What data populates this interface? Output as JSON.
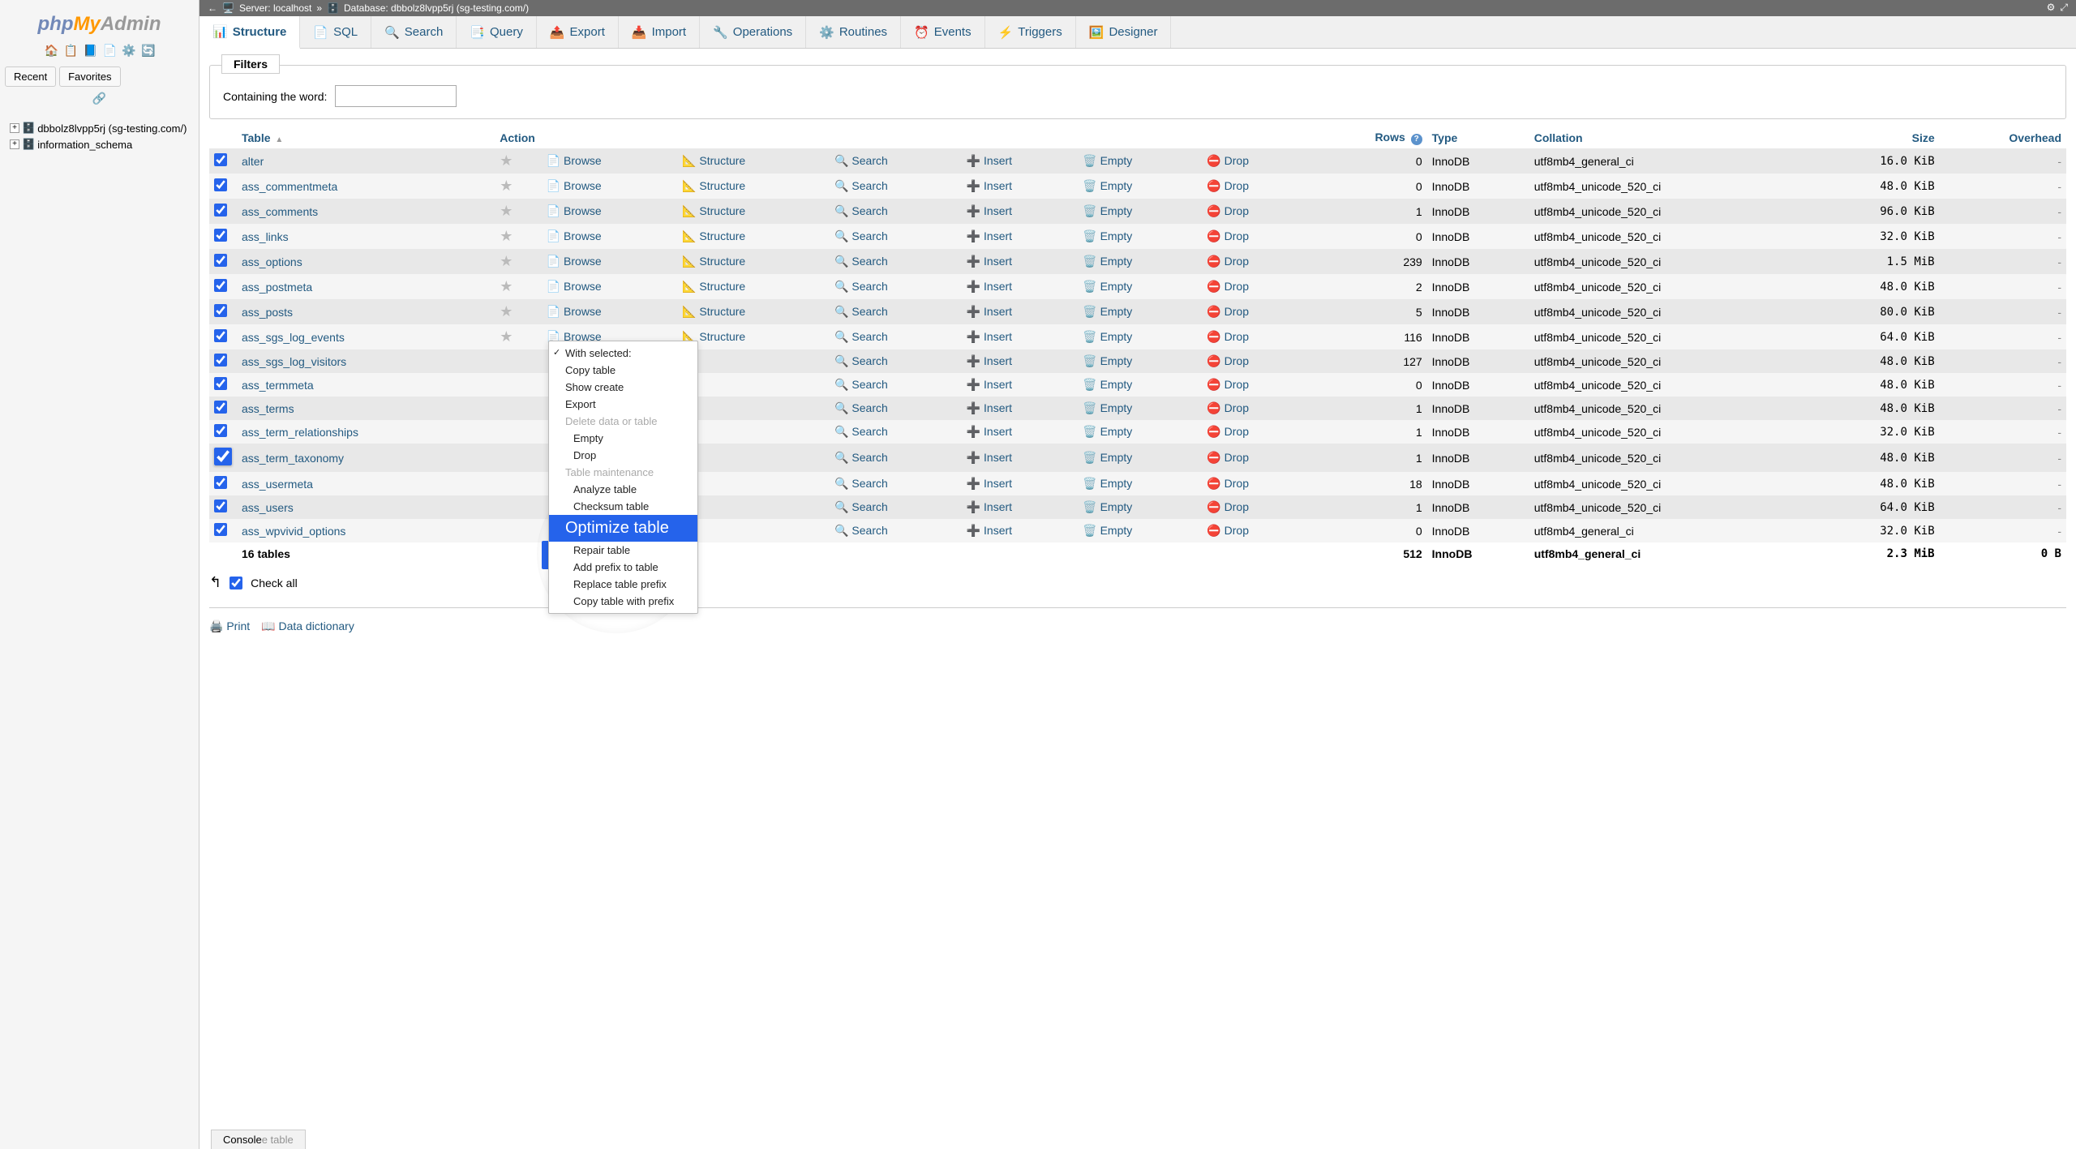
{
  "logo": {
    "php": "php",
    "my": "My",
    "admin": "Admin"
  },
  "sidebar": {
    "recent": "Recent",
    "favorites": "Favorites",
    "tree": [
      {
        "name": "dbbolz8lvpp5rj (sg-testing.com/)"
      },
      {
        "name": "information_schema"
      }
    ]
  },
  "breadcrumb": {
    "server_label": "Server:",
    "server": "localhost",
    "sep": "»",
    "db_label": "Database:",
    "db": "dbbolz8lvpp5rj (sg-testing.com/)"
  },
  "tabs": {
    "structure": "Structure",
    "sql": "SQL",
    "search": "Search",
    "query": "Query",
    "export": "Export",
    "import": "Import",
    "operations": "Operations",
    "routines": "Routines",
    "events": "Events",
    "triggers": "Triggers",
    "designer": "Designer"
  },
  "filters": {
    "legend": "Filters",
    "contain_label": "Containing the word:",
    "value": ""
  },
  "headers": {
    "table": "Table",
    "action": "Action",
    "rows": "Rows",
    "type": "Type",
    "collation": "Collation",
    "size": "Size",
    "overhead": "Overhead"
  },
  "actions": {
    "browse": "Browse",
    "structure": "Structure",
    "search": "Search",
    "insert": "Insert",
    "empty": "Empty",
    "drop": "Drop"
  },
  "rows": [
    {
      "name": "alter",
      "rows": 0,
      "type": "InnoDB",
      "collation": "utf8mb4_general_ci",
      "size": "16.0 KiB",
      "overhead": "-"
    },
    {
      "name": "ass_commentmeta",
      "rows": 0,
      "type": "InnoDB",
      "collation": "utf8mb4_unicode_520_ci",
      "size": "48.0 KiB",
      "overhead": "-"
    },
    {
      "name": "ass_comments",
      "rows": 1,
      "type": "InnoDB",
      "collation": "utf8mb4_unicode_520_ci",
      "size": "96.0 KiB",
      "overhead": "-"
    },
    {
      "name": "ass_links",
      "rows": 0,
      "type": "InnoDB",
      "collation": "utf8mb4_unicode_520_ci",
      "size": "32.0 KiB",
      "overhead": "-"
    },
    {
      "name": "ass_options",
      "rows": 239,
      "type": "InnoDB",
      "collation": "utf8mb4_unicode_520_ci",
      "size": "1.5 MiB",
      "overhead": "-"
    },
    {
      "name": "ass_postmeta",
      "rows": 2,
      "type": "InnoDB",
      "collation": "utf8mb4_unicode_520_ci",
      "size": "48.0 KiB",
      "overhead": "-"
    },
    {
      "name": "ass_posts",
      "rows": 5,
      "type": "InnoDB",
      "collation": "utf8mb4_unicode_520_ci",
      "size": "80.0 KiB",
      "overhead": "-"
    },
    {
      "name": "ass_sgs_log_events",
      "rows": 116,
      "type": "InnoDB",
      "collation": "utf8mb4_unicode_520_ci",
      "size": "64.0 KiB",
      "overhead": "-"
    },
    {
      "name": "ass_sgs_log_visitors",
      "rows": 127,
      "type": "InnoDB",
      "collation": "utf8mb4_unicode_520_ci",
      "size": "48.0 KiB",
      "overhead": "-"
    },
    {
      "name": "ass_termmeta",
      "rows": 0,
      "type": "InnoDB",
      "collation": "utf8mb4_unicode_520_ci",
      "size": "48.0 KiB",
      "overhead": "-"
    },
    {
      "name": "ass_terms",
      "rows": 1,
      "type": "InnoDB",
      "collation": "utf8mb4_unicode_520_ci",
      "size": "48.0 KiB",
      "overhead": "-"
    },
    {
      "name": "ass_term_relationships",
      "rows": 1,
      "type": "InnoDB",
      "collation": "utf8mb4_unicode_520_ci",
      "size": "32.0 KiB",
      "overhead": "-"
    },
    {
      "name": "ass_term_taxonomy",
      "rows": 1,
      "type": "InnoDB",
      "collation": "utf8mb4_unicode_520_ci",
      "size": "48.0 KiB",
      "overhead": "-"
    },
    {
      "name": "ass_usermeta",
      "rows": 18,
      "type": "InnoDB",
      "collation": "utf8mb4_unicode_520_ci",
      "size": "48.0 KiB",
      "overhead": "-"
    },
    {
      "name": "ass_users",
      "rows": 1,
      "type": "InnoDB",
      "collation": "utf8mb4_unicode_520_ci",
      "size": "64.0 KiB",
      "overhead": "-"
    },
    {
      "name": "ass_wpvivid_options",
      "rows": 0,
      "type": "InnoDB",
      "collation": "utf8mb4_general_ci",
      "size": "32.0 KiB",
      "overhead": "-"
    }
  ],
  "summary": {
    "count": "16 tables",
    "rows": 512,
    "type": "InnoDB",
    "collation": "utf8mb4_general_ci",
    "size": "2.3 MiB",
    "overhead": "0 B"
  },
  "footer": {
    "check_all": "Check all",
    "print": "Print",
    "data_dictionary": "Data dictionary"
  },
  "dropdown": {
    "header": "With selected:",
    "copy_table": "Copy table",
    "show_create": "Show create",
    "export": "Export",
    "delete_label": "Delete data or table",
    "empty": "Empty",
    "drop": "Drop",
    "maint_label": "Table maintenance",
    "analyze": "Analyze table",
    "checksum": "Checksum table",
    "optimize": "Optimize table",
    "repair": "Repair table",
    "add_prefix": "Add prefix to table",
    "replace_prefix": "Replace table prefix",
    "copy_prefix": "Copy table with prefix"
  },
  "magnify": {
    "l1": "Analyze table",
    "l2": "Checksum tab",
    "l3": "Optimize table",
    "l4": "Repair table"
  },
  "console": "Console",
  "console_tail": "e table"
}
